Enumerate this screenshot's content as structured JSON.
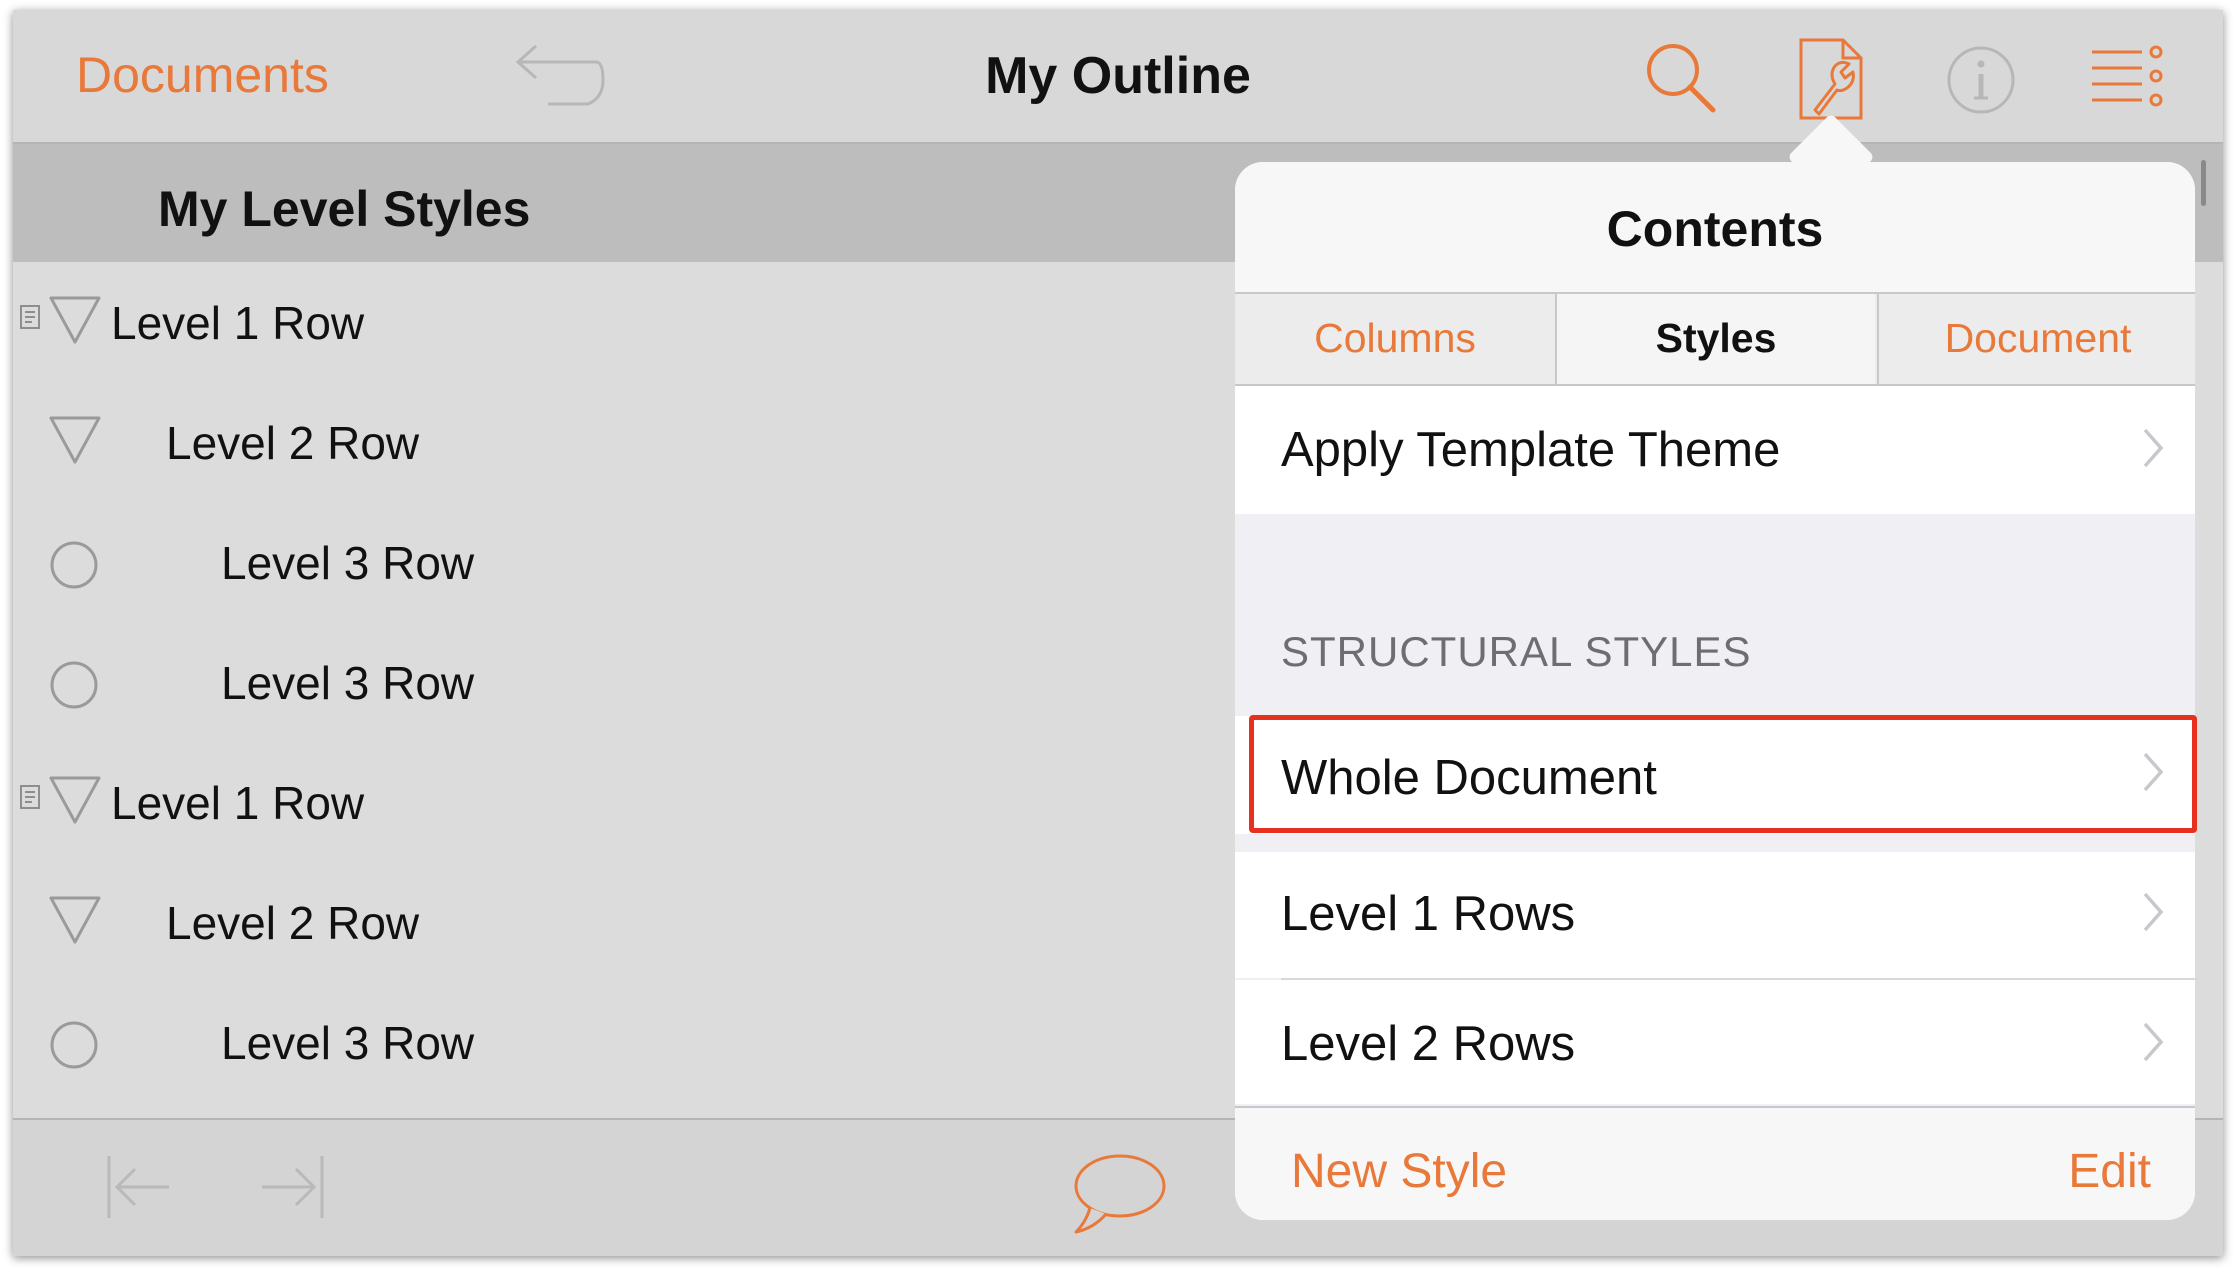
{
  "navbar": {
    "documents_label": "Documents",
    "title": "My Outline",
    "icons": [
      "undo-icon",
      "search-icon",
      "contents-inspector-icon",
      "info-icon",
      "list-settings-icon"
    ]
  },
  "outline": {
    "section_title": "My Level Styles",
    "rows": [
      {
        "label": "Level 1 Row",
        "level": 1,
        "icon": "disclosure-triangle-icon",
        "has_note": true
      },
      {
        "label": "Level 2 Row",
        "level": 2,
        "icon": "disclosure-triangle-icon",
        "has_note": false
      },
      {
        "label": "Level 3 Row",
        "level": 3,
        "icon": "circle-bullet-icon",
        "has_note": false
      },
      {
        "label": "Level 3 Row",
        "level": 3,
        "icon": "circle-bullet-icon",
        "has_note": false
      },
      {
        "label": "Level 1 Row",
        "level": 1,
        "icon": "disclosure-triangle-icon",
        "has_note": true
      },
      {
        "label": "Level 2 Row",
        "level": 2,
        "icon": "disclosure-triangle-icon",
        "has_note": false
      },
      {
        "label": "Level 3 Row",
        "level": 3,
        "icon": "circle-bullet-icon",
        "has_note": false
      }
    ]
  },
  "toolbar": {
    "icons": [
      "outdent-icon",
      "indent-icon",
      "comment-icon"
    ]
  },
  "popover": {
    "title": "Contents",
    "tabs": [
      {
        "label": "Columns",
        "selected": false
      },
      {
        "label": "Styles",
        "selected": true
      },
      {
        "label": "Document",
        "selected": false
      }
    ],
    "apply_template": "Apply Template Theme",
    "section_label": "STRUCTURAL STYLES",
    "styles": [
      {
        "label": "Whole Document",
        "highlighted": true
      },
      {
        "label": "Level 1 Rows",
        "highlighted": false
      },
      {
        "label": "Level 2 Rows",
        "highlighted": false
      }
    ],
    "new_style_label": "New Style",
    "edit_label": "Edit"
  },
  "colors": {
    "accent": "#e8793a",
    "highlight": "#e8301f",
    "background": "#dcdcdc",
    "section_header": "#bdbdbd"
  }
}
